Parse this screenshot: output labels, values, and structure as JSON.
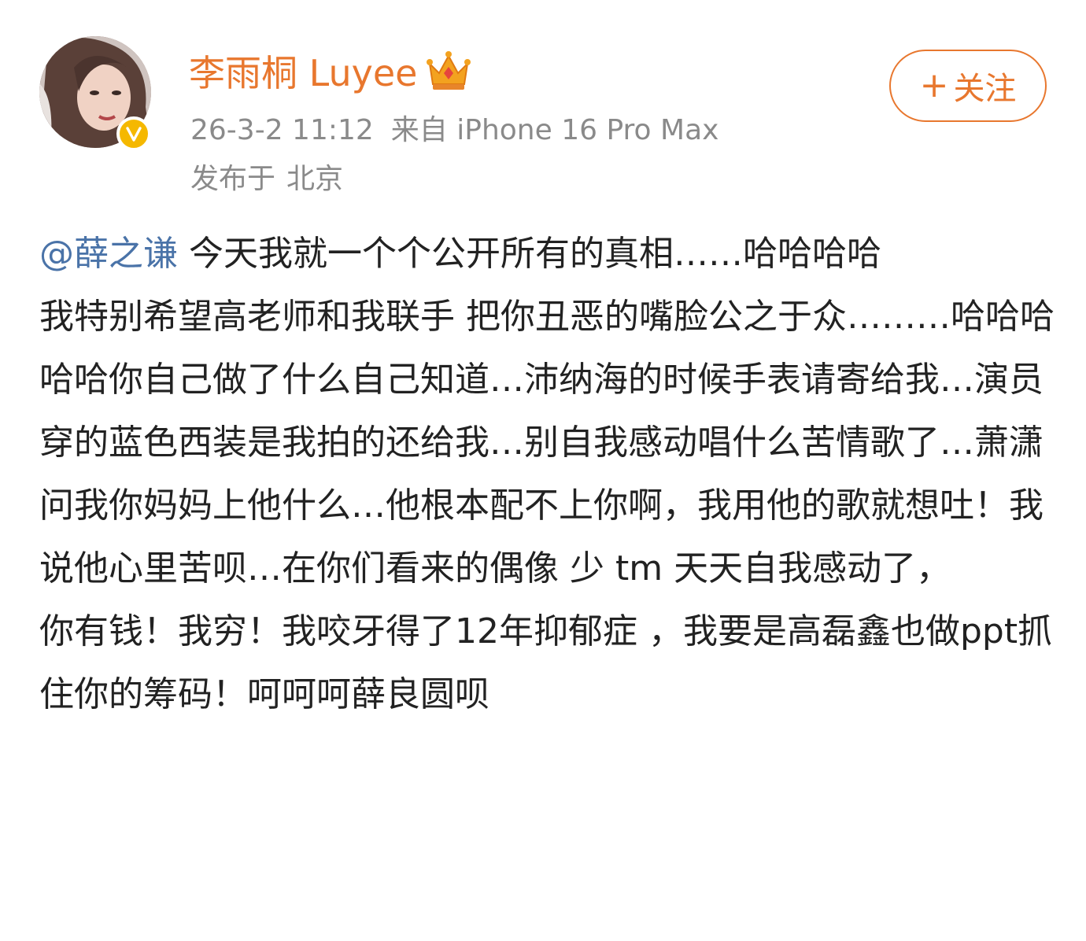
{
  "author": {
    "name": "李雨桐 Luyee",
    "timestamp": "26-3-2 11:12",
    "source": "来自 iPhone 16 Pro Max",
    "location_prefix": "发布于",
    "location": "北京",
    "badge_icon": "verified-icon",
    "vip_icon": "crown-icon"
  },
  "follow_button": {
    "icon": "+",
    "label": "关注"
  },
  "post": {
    "mention": "@薛之谦",
    "paragraphs": [
      " 今天我就一个个公开所有的真相……哈哈哈哈",
      "我特别希望高老师和我联手 把你丑恶的嘴脸公之于众………哈哈哈哈哈你自己做了什么自己知道…沛纳海的时候手表请寄给我…演员穿的蓝色西装是我拍的还给我…别自我感动唱什么苦情歌了…萧潇问我你妈妈上他什么…他根本配不上你啊，我用他的歌就想吐！我说他心里苦呗…在你们看来的偶像 少 tm 天天自我感动了，",
      "你有钱！我穷！我咬牙得了12年抑郁症 ，我要是高磊鑫也做ppt抓住你的筹码！呵呵呵薛良圆呗"
    ]
  },
  "colors": {
    "accent": "#e8772e",
    "mention": "#4a73a8",
    "meta": "#8a8a8a",
    "text": "#222222",
    "badge": "#f5b800"
  }
}
